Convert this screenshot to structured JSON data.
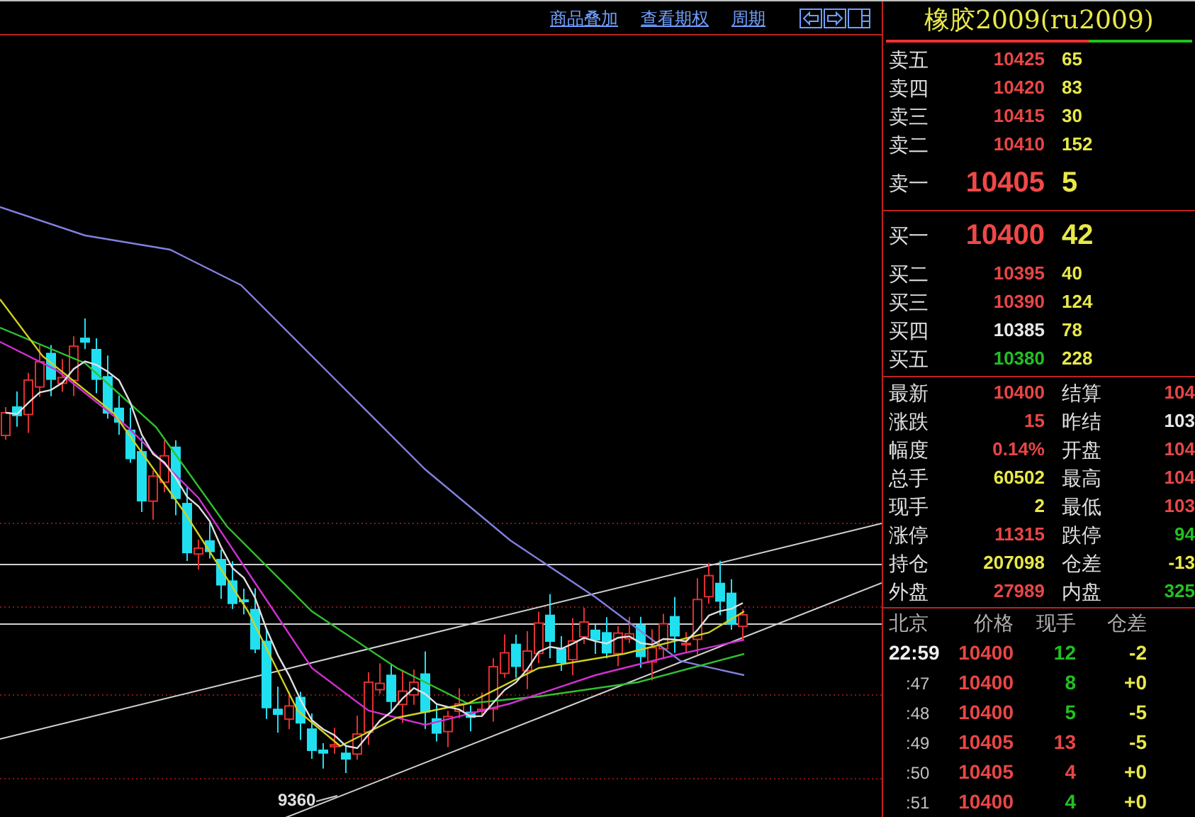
{
  "toolbar": {
    "links": [
      "商品叠加",
      "查看期权",
      "周期"
    ]
  },
  "chart": {
    "low_label": "9360"
  },
  "quote": {
    "title": "橡胶2009(ru2009)",
    "ratio": {
      "level": 0.66
    },
    "asks": [
      {
        "label": "卖五",
        "price": "10425",
        "volume": "65",
        "color": "#e84646",
        "kind": "normal"
      },
      {
        "label": "卖四",
        "price": "10420",
        "volume": "83",
        "color": "#e84646",
        "kind": "normal"
      },
      {
        "label": "卖三",
        "price": "10415",
        "volume": "30",
        "color": "#e84646",
        "kind": "normal"
      },
      {
        "label": "卖二",
        "price": "10410",
        "volume": "152",
        "color": "#e84646",
        "kind": "normal"
      },
      {
        "label": "卖一",
        "price": "10405",
        "volume": "5",
        "color": "#f04848",
        "kind": "best"
      }
    ],
    "bids": [
      {
        "label": "买一",
        "price": "10400",
        "volume": "42",
        "color": "#f04848",
        "kind": "best"
      },
      {
        "label": "买二",
        "price": "10395",
        "volume": "40",
        "color": "#e84646",
        "kind": "normal"
      },
      {
        "label": "买三",
        "price": "10390",
        "volume": "124",
        "color": "#e84646",
        "kind": "normal"
      },
      {
        "label": "买四",
        "price": "10385",
        "volume": "78",
        "color": "#e8e8e8",
        "kind": "normal"
      },
      {
        "label": "买五",
        "price": "10380",
        "volume": "228",
        "color": "#22c022",
        "kind": "normal"
      }
    ],
    "stats": [
      {
        "left": {
          "label": "最新",
          "value": "10400",
          "color": "#e84646"
        },
        "right": {
          "label": "结算",
          "value": "104",
          "color": "#e84646"
        }
      },
      {
        "left": {
          "label": "涨跌",
          "value": "15",
          "color": "#e84646"
        },
        "right": {
          "label": "昨结",
          "value": "103",
          "color": "#e8e8e8"
        }
      },
      {
        "left": {
          "label": "幅度",
          "value": "0.14%",
          "color": "#e84646"
        },
        "right": {
          "label": "开盘",
          "value": "104",
          "color": "#e84646"
        }
      },
      {
        "left": {
          "label": "总手",
          "value": "60502",
          "color": "#e8e84a"
        },
        "right": {
          "label": "最高",
          "value": "104",
          "color": "#e84646"
        }
      },
      {
        "left": {
          "label": "现手",
          "value": "2",
          "color": "#e8e84a"
        },
        "right": {
          "label": "最低",
          "value": "103",
          "color": "#e84646"
        }
      },
      {
        "left": {
          "label": "涨停",
          "value": "11315",
          "color": "#e84646"
        },
        "right": {
          "label": "跌停",
          "value": "94",
          "color": "#22c022"
        }
      },
      {
        "left": {
          "label": "持仓",
          "value": "207098",
          "color": "#e8e84a"
        },
        "right": {
          "label": "仓差",
          "value": "-13",
          "color": "#e8e84a"
        }
      },
      {
        "left": {
          "label": "外盘",
          "value": "27989",
          "color": "#e84646"
        },
        "right": {
          "label": "内盘",
          "value": "325",
          "color": "#22c022"
        }
      }
    ],
    "ticks": {
      "columns": [
        "北京",
        "价格",
        "现手",
        "仓差"
      ],
      "rows": [
        {
          "kind": "full",
          "time": "22:59",
          "price": {
            "text": "10400",
            "color": "#e84646"
          },
          "volume": {
            "text": "12",
            "color": "#22c022"
          },
          "change": "-2"
        },
        {
          "kind": "minute",
          "time": ":47",
          "price": {
            "text": "10400",
            "color": "#e84646"
          },
          "volume": {
            "text": "8",
            "color": "#22c022"
          },
          "change": "+0"
        },
        {
          "kind": "minute",
          "time": ":48",
          "price": {
            "text": "10400",
            "color": "#e84646"
          },
          "volume": {
            "text": "5",
            "color": "#22c022"
          },
          "change": "-5"
        },
        {
          "kind": "minute",
          "time": ":49",
          "price": {
            "text": "10405",
            "color": "#e84646"
          },
          "volume": {
            "text": "13",
            "color": "#e84646"
          },
          "change": "-5"
        },
        {
          "kind": "minute",
          "time": ":50",
          "price": {
            "text": "10405",
            "color": "#e84646"
          },
          "volume": {
            "text": "4",
            "color": "#e84646"
          },
          "change": "+0"
        },
        {
          "kind": "minute",
          "time": ":51",
          "price": {
            "text": "10400",
            "color": "#e84646"
          },
          "volume": {
            "text": "4",
            "color": "#22c022"
          },
          "change": "+0"
        }
      ]
    }
  }
}
